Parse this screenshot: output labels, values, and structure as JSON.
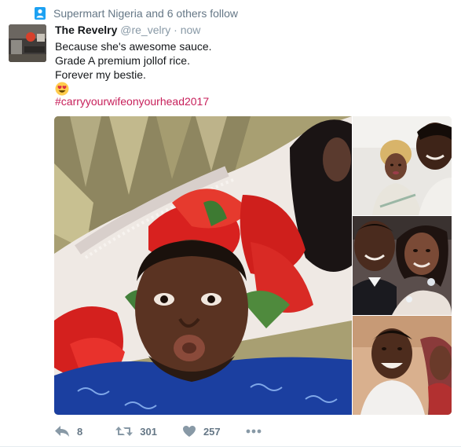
{
  "context": {
    "text": "Supermart Nigeria and 6 others follow",
    "icon": "person-icon"
  },
  "tweet": {
    "display_name": "The Revelry",
    "handle": "@re_velry",
    "separator": "·",
    "timestamp": "now",
    "lines": [
      "Because she's awesome sauce.",
      "Grade A premium jollof rice.",
      "Forever my bestie."
    ],
    "emoji": "heart-eyes-emoji",
    "hashtag": "#carryyourwifeonyourhead2017"
  },
  "media": {
    "photos": [
      {
        "name": "photo-selfie-main"
      },
      {
        "name": "photo-couple-1"
      },
      {
        "name": "photo-couple-2"
      },
      {
        "name": "photo-couple-3"
      }
    ]
  },
  "actions": {
    "reply": {
      "icon": "reply-icon",
      "count": "8"
    },
    "retweet": {
      "icon": "retweet-icon",
      "count": "301"
    },
    "like": {
      "icon": "heart-icon",
      "count": "257"
    },
    "more": {
      "icon": "more-dots-icon"
    }
  },
  "colors": {
    "hashtag": "#c71f5a",
    "meta_gray": "#657786",
    "context_icon": "#1da1f2"
  }
}
